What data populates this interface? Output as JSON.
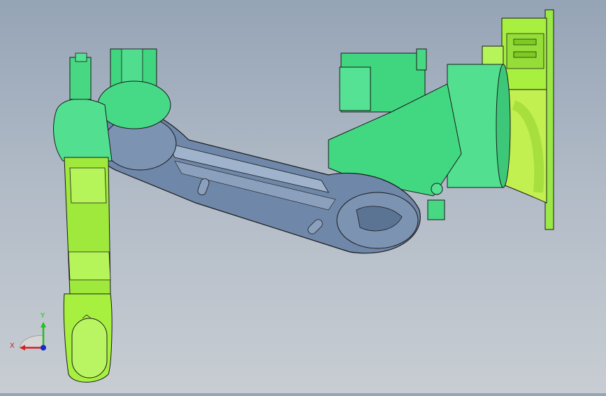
{
  "viewport": {
    "background_top": "#95a4b6",
    "background_bottom": "#c8cdd3"
  },
  "model": {
    "colors": {
      "green_dark": "#3fd67f",
      "green_light": "#7ff0a8",
      "lime": "#a8f040",
      "lime_dark": "#7ccc20",
      "arm_blue": "#6f87a8",
      "arm_blue_light": "#9fb4cc",
      "edge": "#1a1a1a"
    }
  },
  "triad": {
    "x_label": "X",
    "y_label": "Y",
    "x_color": "#d42020",
    "y_color": "#22c022",
    "z_color": "#1a28d0"
  }
}
